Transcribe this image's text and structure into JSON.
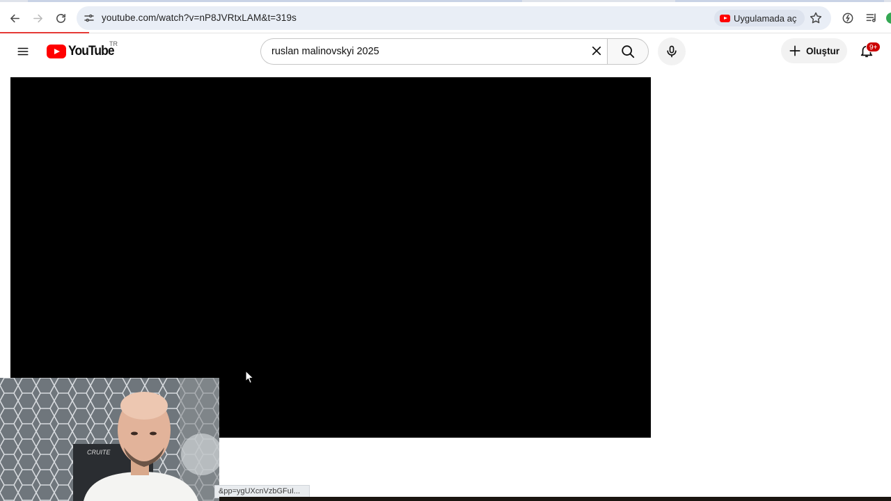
{
  "browser": {
    "url": "youtube.com/watch?v=nP8JVRtxLAM&t=319s",
    "open_in_app_label": "Uygulamada aç",
    "status_url": "&pp=ygUXcnVzbGFuI..."
  },
  "youtube": {
    "logo_text": "YouTube",
    "country_code": "TR",
    "search_query": "ruslan malinovskyi 2025",
    "create_label": "Oluştur",
    "notification_count": "9+"
  },
  "colors": {
    "brand_red": "#ff0000",
    "badge_red": "#cc0000",
    "player_bg": "#000000",
    "omnibox_bg": "#e9eef6"
  },
  "icons": {
    "back": "arrow-left-icon",
    "forward": "arrow-right-icon",
    "reload": "reload-icon",
    "site_info": "tune-icon",
    "bookmark": "star-icon",
    "menu": "hamburger-icon",
    "clear": "close-icon",
    "search": "search-icon",
    "mic": "microphone-icon",
    "create": "plus-icon",
    "notifications": "bell-icon"
  }
}
